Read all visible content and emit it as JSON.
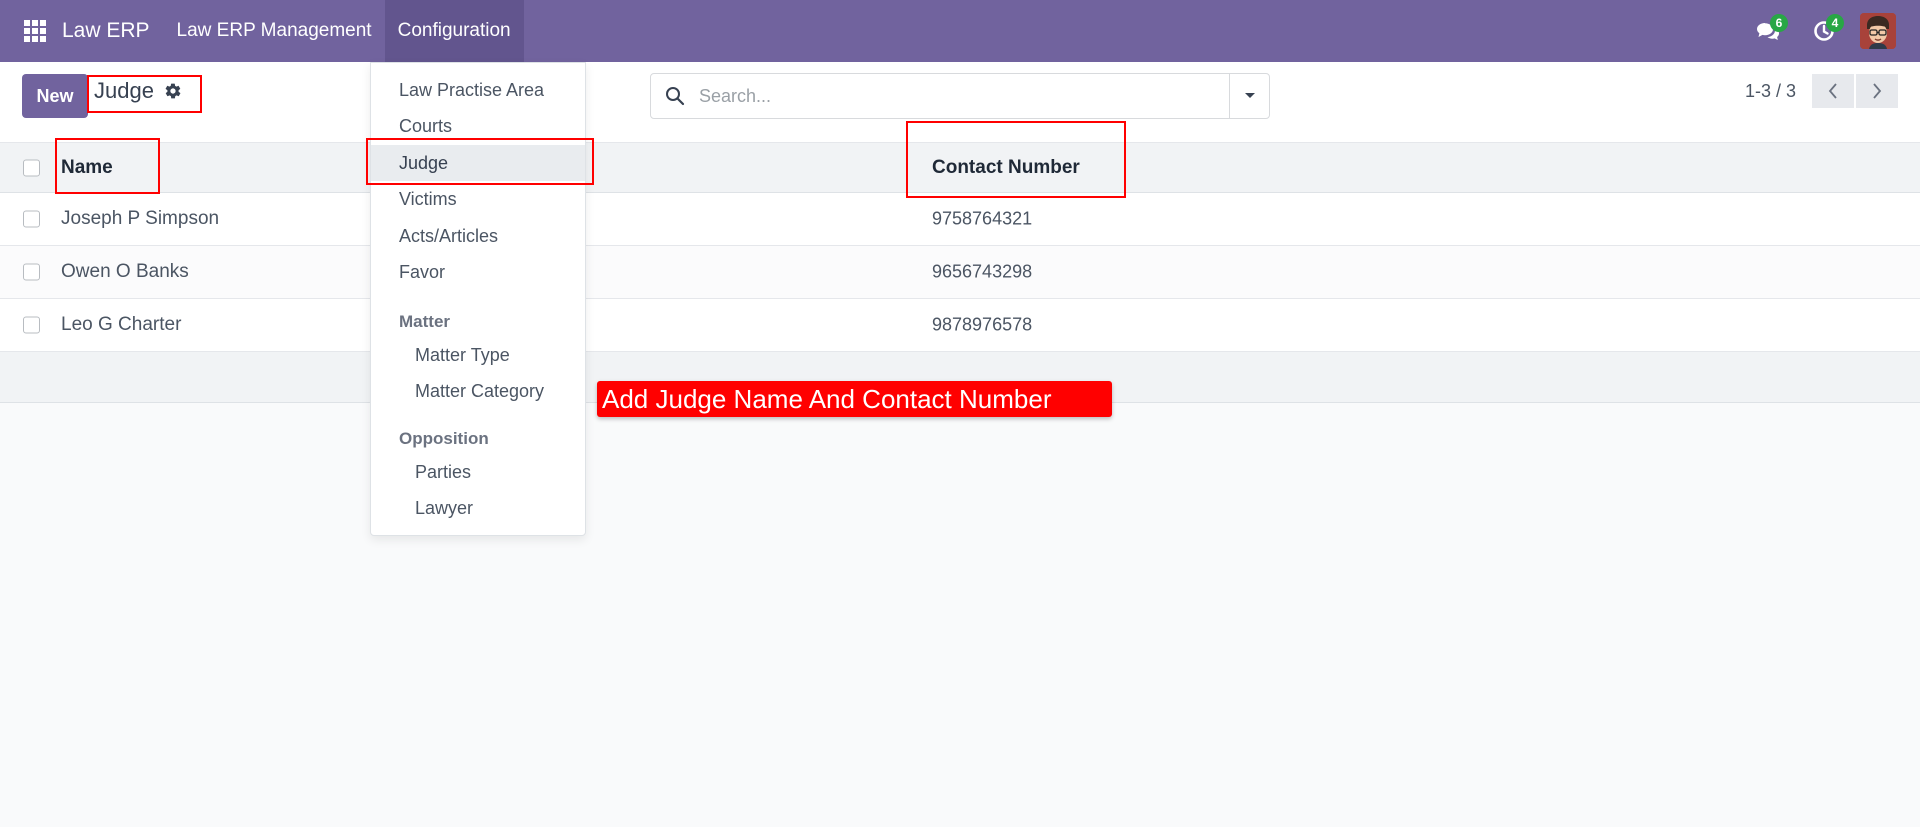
{
  "navbar": {
    "app_name": "Law ERP",
    "menus": [
      {
        "label": "Law ERP Management"
      },
      {
        "label": "Configuration"
      }
    ],
    "messages_count": "6",
    "activities_count": "4",
    "accent_color": "#71639e"
  },
  "control": {
    "new_label": "New",
    "breadcrumb": "Judge",
    "search_placeholder": "Search...",
    "pager": "1-3 / 3"
  },
  "table": {
    "columns": [
      "Name",
      "Contact Number"
    ],
    "rows": [
      {
        "name": "Joseph P Simpson",
        "contact": "9758764321"
      },
      {
        "name": "Owen O Banks",
        "contact": "9656743298"
      },
      {
        "name": "Leo G Charter",
        "contact": "9878976578"
      }
    ]
  },
  "dropdown": {
    "items": [
      {
        "label": "Law Practise Area"
      },
      {
        "label": "Courts"
      },
      {
        "label": "Judge"
      },
      {
        "label": "Victims"
      },
      {
        "label": "Acts/Articles"
      },
      {
        "label": "Favor"
      }
    ],
    "sections": [
      {
        "header": "Matter",
        "items": [
          {
            "label": "Matter Type"
          },
          {
            "label": "Matter Category"
          }
        ]
      },
      {
        "header": "Opposition",
        "items": [
          {
            "label": "Parties"
          },
          {
            "label": "Lawyer"
          }
        ]
      }
    ]
  },
  "annotation": {
    "callout_text": "Add Judge Name And Contact Number",
    "color": "#ff0000"
  }
}
